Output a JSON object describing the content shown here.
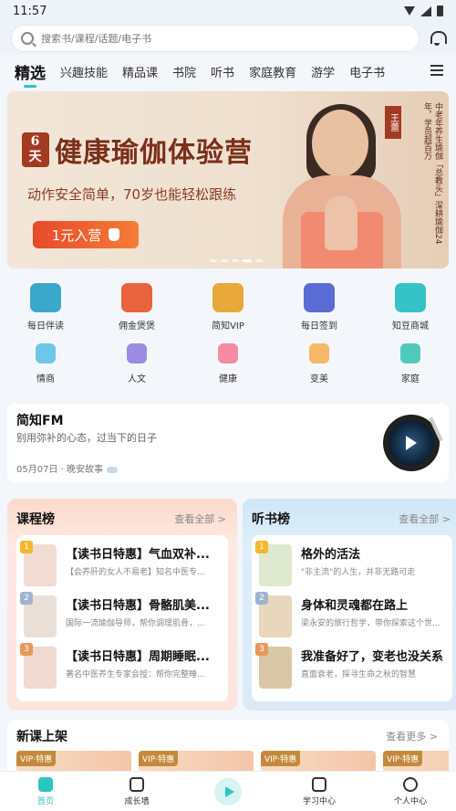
{
  "status_bar": {
    "time": "11:57"
  },
  "search": {
    "placeholder": "搜索书/课程/话题/电子书"
  },
  "tabs": [
    "精选",
    "兴趣技能",
    "精品课",
    "书院",
    "听书",
    "家庭教育",
    "游学",
    "电子书"
  ],
  "banner": {
    "days": [
      "6",
      "天"
    ],
    "title": "健康瑜伽体验营",
    "subtitle": "动作安全简单，70岁也能轻松跟练",
    "button": "1元入营",
    "name": "王蕾",
    "vertical_text": "中老年养生瑜伽「总教头」深耕瑜伽24年，学员超百万"
  },
  "grid": [
    {
      "label": "每日伴读",
      "color": "#3aa9c9"
    },
    {
      "label": "佣金煲煲",
      "color": "#e8643c"
    },
    {
      "label": "简知VIP",
      "color": "#e8a93a"
    },
    {
      "label": "每日签到",
      "color": "#5b6bd6"
    },
    {
      "label": "知豆商城",
      "color": "#35c3c7"
    },
    {
      "label": "情商",
      "color": "#6cc7e8"
    },
    {
      "label": "人文",
      "color": "#9b8be4"
    },
    {
      "label": "健康",
      "color": "#f38ba2"
    },
    {
      "label": "变美",
      "color": "#f4b867"
    },
    {
      "label": "家庭",
      "color": "#4fcab9"
    }
  ],
  "fm": {
    "title": "简知FM",
    "subtitle": "别用弥补的心态，过当下的日子",
    "date": "05月07日 · 晚安故事"
  },
  "course_rank": {
    "title": "课程榜",
    "more": "查看全部 >",
    "items": [
      {
        "num": "1",
        "name": "【读书日特惠】气血双补...",
        "desc": "【会养肝的女人不易老】知名中医专..."
      },
      {
        "num": "2",
        "name": "【读书日特惠】骨骼肌美...",
        "desc": "国际一流瑜伽导师，帮你调理肌骨，..."
      },
      {
        "num": "3",
        "name": "【读书日特惠】周期睡眠...",
        "desc": "著名中医养生专家会授：帮你完整睡..."
      }
    ]
  },
  "audio_rank": {
    "title": "听书榜",
    "more": "查看全部 >",
    "items": [
      {
        "num": "1",
        "name": "格外的活法",
        "desc": "\"非主流\"的人生，并非无路可走"
      },
      {
        "num": "2",
        "name": "身体和灵魂都在路上",
        "desc": "梁永安的旅行哲学，带你探索这个世..."
      },
      {
        "num": "3",
        "name": "我准备好了，变老也没关系",
        "desc": "直面衰老，探寻生命之秋的智慧"
      }
    ]
  },
  "new_courses": {
    "title": "新课上架",
    "more": "查看更多 >",
    "badges": [
      "VIP·特惠",
      "VIP·特惠",
      "VIP·特惠",
      "VIP·特惠"
    ]
  },
  "tabbar": [
    "首页",
    "成长墙",
    "学习中心",
    "个人中心"
  ],
  "colors": {
    "accent": "#2bc6c1",
    "banner_title": "#7a2f1a",
    "banner_button": "#e8492a"
  }
}
